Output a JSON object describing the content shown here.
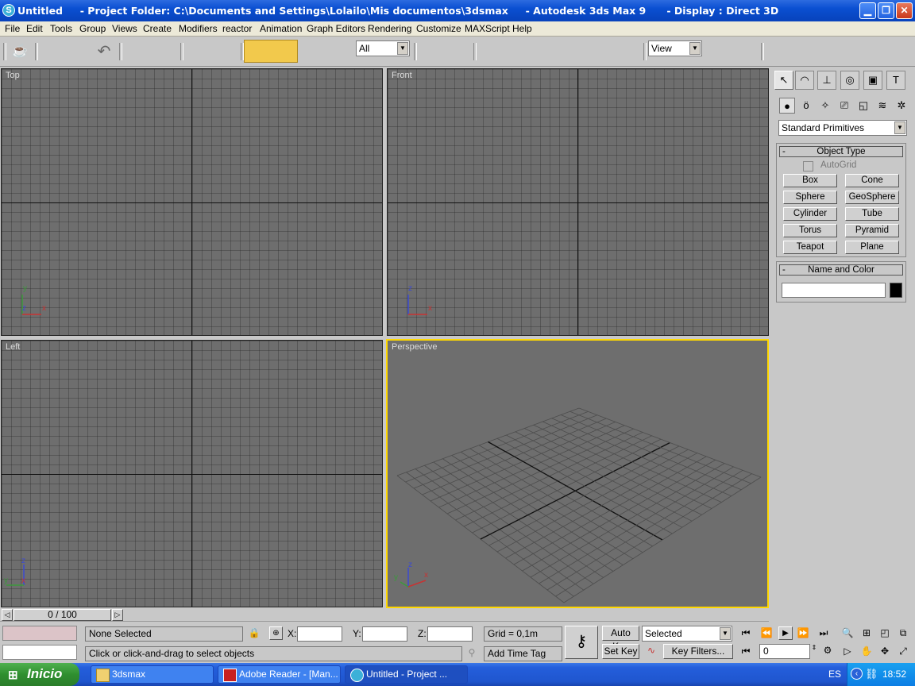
{
  "window": {
    "title": "Untitled     - Project Folder: C:\\Documents and Settings\\Lolailo\\Mis documentos\\3dsmax     - Autodesk 3ds Max 9      - Display : Direct 3D",
    "app_icon_label": "S"
  },
  "menu": [
    "File",
    "Edit",
    "Tools",
    "Group",
    "Views",
    "Create",
    "Modifiers",
    "reactor",
    "Animation",
    "Graph Editors",
    "Rendering",
    "Customize",
    "MAXScript",
    "Help"
  ],
  "toolbar": {
    "selection_filter": "All",
    "reference_coord": "View",
    "accent_color": "#f2c94c"
  },
  "viewports": {
    "top": "Top",
    "front": "Front",
    "left": "Left",
    "perspective": "Perspective"
  },
  "axes": {
    "x": "x",
    "y": "y",
    "z": "z"
  },
  "command_panel": {
    "category_dropdown": "Standard Primitives",
    "object_type": {
      "title": "Object Type",
      "autogrid": "AutoGrid",
      "buttons": [
        "Box",
        "Cone",
        "Sphere",
        "GeoSphere",
        "Cylinder",
        "Tube",
        "Torus",
        "Pyramid",
        "Teapot",
        "Plane"
      ]
    },
    "name_and_color": {
      "title": "Name and Color",
      "name_value": "",
      "color": "#000000"
    },
    "collapse_glyph": "-"
  },
  "timeline": {
    "frame_label": "0 / 100"
  },
  "status": {
    "selection": "None Selected",
    "prompt": "Click or click-and-drag to select objects",
    "x_label": "X:",
    "y_label": "Y:",
    "z_label": "Z:",
    "x_value": "",
    "y_value": "",
    "z_value": "",
    "grid": "Grid = 0,1m",
    "add_time_tag": "Add Time Tag",
    "auto_key": "Auto Key",
    "set_key": "Set Key",
    "key_mode_dropdown": "Selected",
    "key_filters": "Key Filters...",
    "current_frame": "0"
  },
  "taskbar": {
    "start": "Inicio",
    "tasks": [
      "3dsmax",
      "Adobe Reader - [Man...",
      "Untitled     - Project ..."
    ],
    "lang": "ES",
    "time": "18:52"
  }
}
